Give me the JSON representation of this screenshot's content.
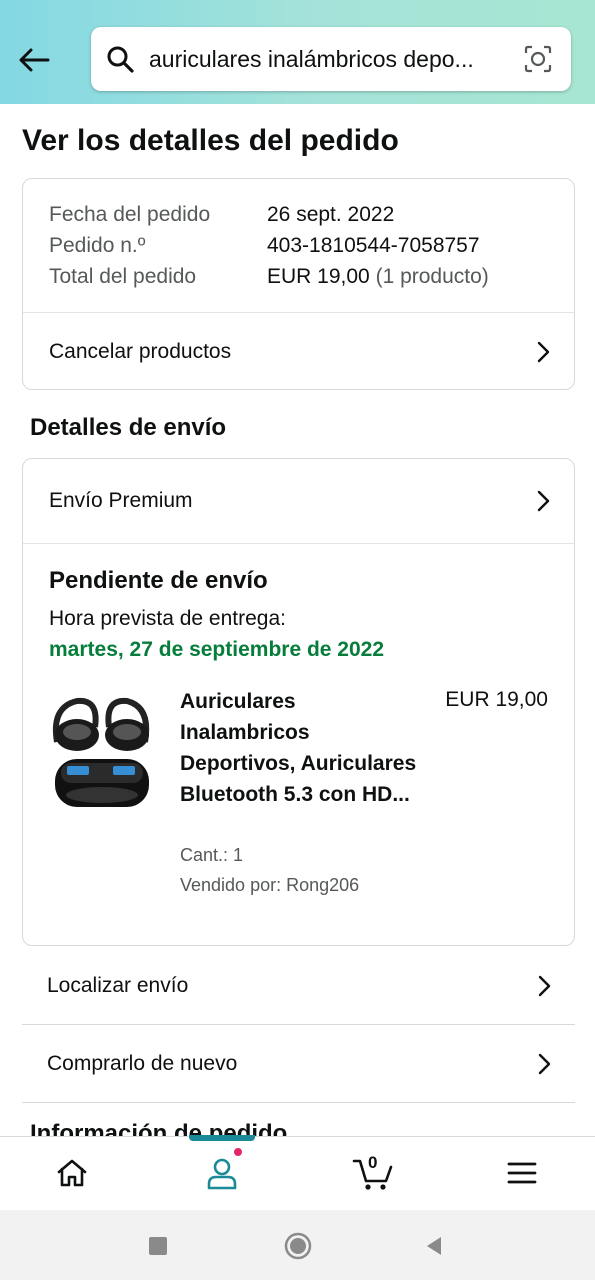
{
  "header": {
    "search_text": "auriculares inalámbricos depo..."
  },
  "page": {
    "title": "Ver los detalles del pedido"
  },
  "order_summary": {
    "date_label": "Fecha del pedido",
    "date_value": "26 sept. 2022",
    "number_label": "Pedido n.º",
    "number_value": "403-1810544-7058757",
    "total_label": "Total del pedido",
    "total_value": "EUR 19,00",
    "total_note": "(1 producto)",
    "cancel_label": "Cancelar productos"
  },
  "shipping": {
    "section_title": "Detalles de envío",
    "shipping_type": "Envío Premium",
    "status": "Pendiente de envío",
    "eta_label": "Hora prevista de entrega:",
    "eta_date": "martes, 27 de septiembre de 2022",
    "product": {
      "name": "Auriculares Inalambricos Deportivos, Auriculares Bluetooth 5.3 con HD...",
      "price": "EUR 19,00",
      "quantity": "Cant.: 1",
      "seller": "Vendido por: Rong206",
      "image_icon": "earbuds-product-image"
    }
  },
  "actions": {
    "track_label": "Localizar envío",
    "buy_again_label": "Comprarlo de nuevo"
  },
  "next_section_partial": "Información de pedido",
  "bottom_nav": {
    "items": [
      "home-icon",
      "account-icon",
      "cart-icon",
      "menu-icon"
    ],
    "cart_count": "0",
    "active": "account-icon"
  },
  "system_nav": {
    "items": [
      "recents-icon",
      "home-circle-icon",
      "back-triangle-icon"
    ]
  },
  "colors": {
    "header_gradient_start": "#84d8e3",
    "header_gradient_end": "#a7e6d2",
    "eta_green": "#067d3b",
    "active_teal": "#1a8a98",
    "notification_pink": "#e3256b"
  }
}
